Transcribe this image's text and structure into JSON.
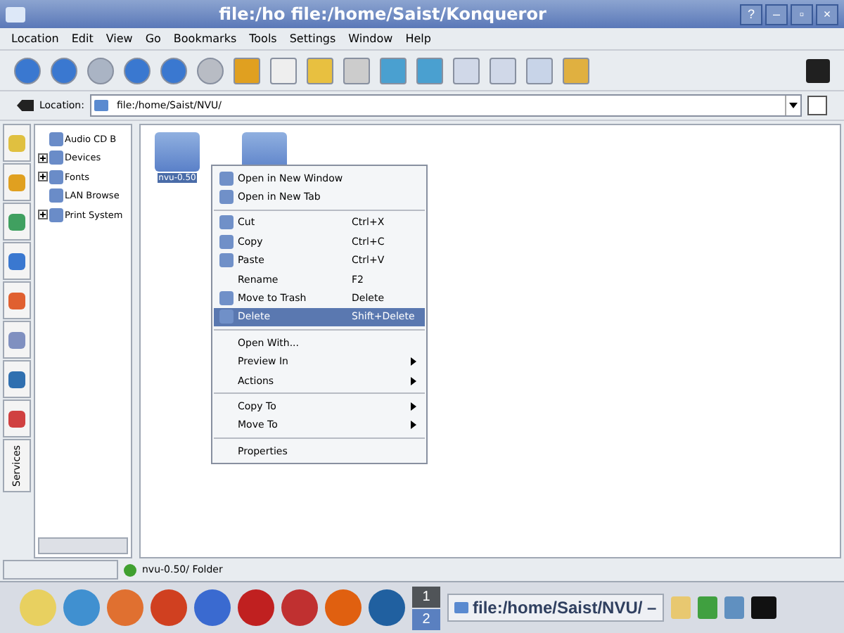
{
  "window": {
    "title": "file:/ho file:/home/Saist/Konqueror",
    "buttons": [
      "?",
      "–",
      "▫",
      "×"
    ]
  },
  "menubar": [
    "Location",
    "Edit",
    "View",
    "Go",
    "Bookmarks",
    "Tools",
    "Settings",
    "Window",
    "Help"
  ],
  "location": {
    "label": "Location:",
    "value": "file:/home/Saist/NVU/"
  },
  "sidebar": {
    "tab_label": "Services",
    "tree": [
      {
        "label": "Audio CD B",
        "expandable": false
      },
      {
        "label": "Devices",
        "expandable": true
      },
      {
        "label": "Fonts",
        "expandable": true
      },
      {
        "label": "LAN Browse",
        "expandable": false
      },
      {
        "label": "Print System",
        "expandable": true
      }
    ]
  },
  "files": [
    {
      "name": "nvu-0.50",
      "selected": true
    }
  ],
  "context_menu": [
    {
      "kind": "item",
      "label": "Open in New Window",
      "icon": true,
      "selected": false
    },
    {
      "kind": "item",
      "label": "Open in New Tab",
      "icon": true,
      "selected": false
    },
    {
      "kind": "separator"
    },
    {
      "kind": "item",
      "label": "Cut",
      "shortcut": "Ctrl+X",
      "icon": true,
      "selected": false
    },
    {
      "kind": "item",
      "label": "Copy",
      "shortcut": "Ctrl+C",
      "icon": true,
      "selected": false
    },
    {
      "kind": "item",
      "label": "Paste",
      "shortcut": "Ctrl+V",
      "icon": true,
      "selected": false
    },
    {
      "kind": "item",
      "label": "Rename",
      "shortcut": "F2",
      "icon": false,
      "selected": false
    },
    {
      "kind": "item",
      "label": "Move to Trash",
      "shortcut": "Delete",
      "icon": true,
      "selected": false
    },
    {
      "kind": "item",
      "label": "Delete",
      "shortcut": "Shift+Delete",
      "icon": true,
      "selected": true
    },
    {
      "kind": "separator"
    },
    {
      "kind": "item",
      "label": "Open With...",
      "icon": false,
      "selected": false
    },
    {
      "kind": "submenu",
      "label": "Preview In",
      "icon": false,
      "selected": false
    },
    {
      "kind": "submenu",
      "label": "Actions",
      "icon": false,
      "selected": false
    },
    {
      "kind": "separator"
    },
    {
      "kind": "submenu",
      "label": "Copy To",
      "icon": false,
      "selected": false
    },
    {
      "kind": "submenu",
      "label": "Move To",
      "icon": false,
      "selected": false
    },
    {
      "kind": "separator"
    },
    {
      "kind": "item",
      "label": "Properties",
      "icon": false,
      "selected": false
    }
  ],
  "status_bar": {
    "text": "nvu-0.50/  Folder"
  },
  "taskbar": {
    "desktops": [
      {
        "label": "1",
        "selected": false
      },
      {
        "label": "2",
        "selected": true
      }
    ],
    "task": "file:/home/Saist/NVU/ –"
  }
}
